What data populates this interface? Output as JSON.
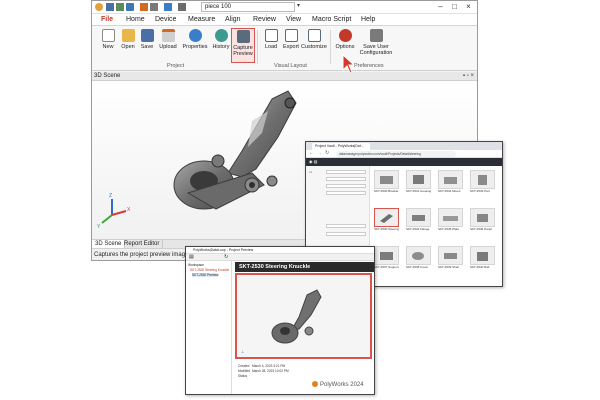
{
  "app": {
    "title_input": "piece 100",
    "menu": [
      "File",
      "Home",
      "Device",
      "Measure",
      "Align",
      "Review",
      "View",
      "Macro Script",
      "Help"
    ],
    "ribbon_buttons": [
      {
        "label": "New",
        "icon": "new-document-icon"
      },
      {
        "label": "Open",
        "icon": "folder-open-icon"
      },
      {
        "label": "Save",
        "icon": "save-icon"
      },
      {
        "label": "Upload",
        "icon": "upload-icon"
      },
      {
        "label": "Properties",
        "icon": "properties-icon"
      },
      {
        "label": "History",
        "icon": "history-icon"
      },
      {
        "label": "Capture Preview",
        "icon": "camera-icon"
      },
      {
        "label": "Load",
        "icon": "load-layout-icon"
      },
      {
        "label": "Export",
        "icon": "export-layout-icon"
      },
      {
        "label": "Customize",
        "icon": "customize-icon"
      },
      {
        "label": "Options",
        "icon": "options-icon"
      },
      {
        "label": "Save User Configuration",
        "icon": "save-config-icon"
      }
    ],
    "group_labels": [
      "Project",
      "Visual Layout",
      "Preferences"
    ],
    "scene_title": "3D Scene",
    "bottom_tabs": [
      "3D Scene",
      "Report Editor"
    ],
    "status_text": "Captures the project preview image",
    "accent_color": "#c0392b",
    "highlight_color": "#d9534f"
  },
  "browser": {
    "tab_title": "Project Vault - PolyWorks|Dat...",
    "url": "datamanager.polyworks.com/vault/Projects/Detail/steering",
    "thumbnails": [
      "SKT-2530 Bracket",
      "SKT-2531 Housing",
      "SKT-2532 Mount",
      "SKT-2533 Part",
      "SKT-2530 Steering Knuckle",
      "SKT-2534 Flange",
      "SKT-2535 Plate",
      "SKT-2536 Panel",
      "SKT-2537 Support",
      "SKT-2538 Cover",
      "SKT-2539 Shell",
      "SKT-2540 Rail"
    ]
  },
  "dialog": {
    "title": "PolyWorks|DataLoop - Project Preview",
    "tree_items": [
      "Workspace",
      "SKT-2530 Steering Knuckle",
      "SKT-2530 Preview"
    ],
    "heading": "SKT-2530 Steering Knuckle",
    "properties": [
      {
        "label": "Created",
        "value": "March 4, 2023 3:21 PM"
      },
      {
        "label": "Modified",
        "value": "March 28, 2023 10:02 PM"
      },
      {
        "label": "Status",
        "value": ""
      }
    ],
    "brand": "PolyWorks 2024"
  }
}
